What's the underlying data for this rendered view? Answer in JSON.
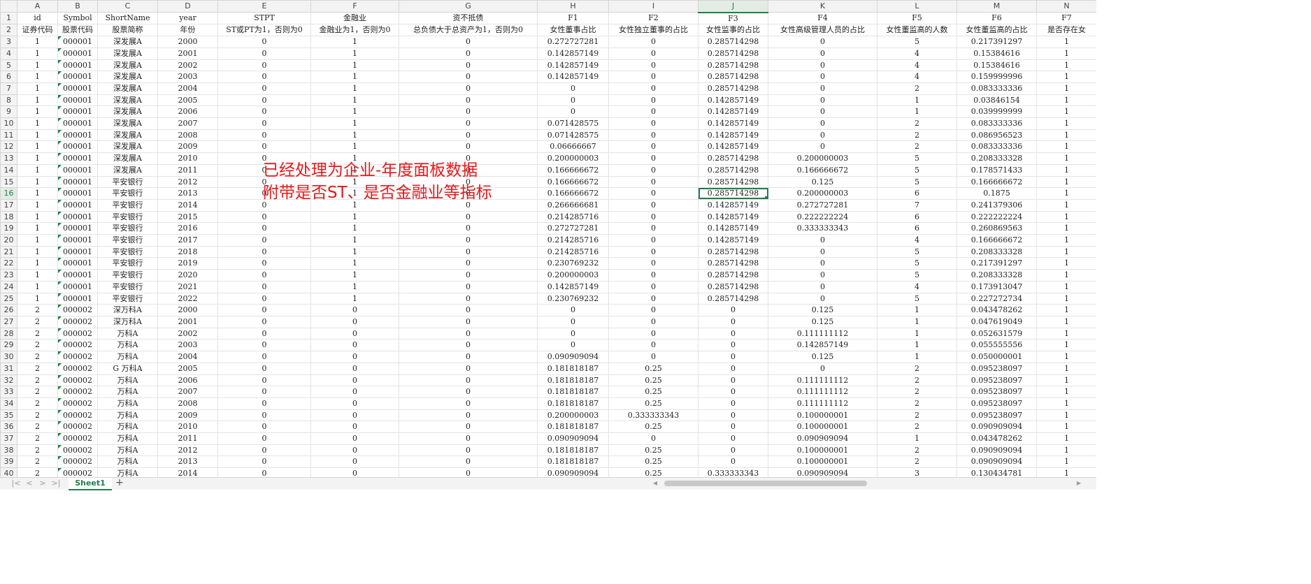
{
  "sheet": {
    "tab_label": "Sheet1",
    "add_sheet_label": "+",
    "nav": [
      "|<",
      "<",
      ">",
      ">|"
    ],
    "active_cell": {
      "row": 16,
      "col": "J"
    },
    "columns": [
      "A",
      "B",
      "C",
      "D",
      "E",
      "F",
      "G",
      "H",
      "I",
      "J",
      "K",
      "L",
      "M",
      "N"
    ],
    "header_row1": [
      "id",
      "Symbol",
      "ShortName",
      "year",
      "STPT",
      "金融业",
      "资不抵债",
      "F1",
      "F2",
      "F3",
      "F4",
      "F5",
      "F6",
      "F7"
    ],
    "header_row2": [
      "证券代码",
      "股票代码",
      "股票简称",
      "年份",
      "ST或PT为1，否则为0",
      "金融业为1，否则为0",
      "总负债大于总资产为1，否则为0",
      "女性董事占比",
      "女性独立董事的占比",
      "女性监事的占比",
      "女性高级管理人员的占比",
      "女性董监高的人数",
      "女性董监高的占比",
      "是否存在女"
    ],
    "rows": [
      {
        "n": 3,
        "c": [
          "1",
          "000001",
          "深发展A",
          "2000",
          "0",
          "1",
          "0",
          "0.272727281",
          "0",
          "0.285714298",
          "0",
          "5",
          "0.217391297",
          "1"
        ]
      },
      {
        "n": 4,
        "c": [
          "1",
          "000001",
          "深发展A",
          "2001",
          "0",
          "1",
          "0",
          "0.142857149",
          "0",
          "0.285714298",
          "0",
          "4",
          "0.15384616",
          "1"
        ]
      },
      {
        "n": 5,
        "c": [
          "1",
          "000001",
          "深发展A",
          "2002",
          "0",
          "1",
          "0",
          "0.142857149",
          "0",
          "0.285714298",
          "0",
          "4",
          "0.15384616",
          "1"
        ]
      },
      {
        "n": 6,
        "c": [
          "1",
          "000001",
          "深发展A",
          "2003",
          "0",
          "1",
          "0",
          "0.142857149",
          "0",
          "0.285714298",
          "0",
          "4",
          "0.159999996",
          "1"
        ]
      },
      {
        "n": 7,
        "c": [
          "1",
          "000001",
          "深发展A",
          "2004",
          "0",
          "1",
          "0",
          "0",
          "0",
          "0.285714298",
          "0",
          "2",
          "0.083333336",
          "1"
        ]
      },
      {
        "n": 8,
        "c": [
          "1",
          "000001",
          "深发展A",
          "2005",
          "0",
          "1",
          "0",
          "0",
          "0",
          "0.142857149",
          "0",
          "1",
          "0.03846154",
          "1"
        ]
      },
      {
        "n": 9,
        "c": [
          "1",
          "000001",
          "深发展A",
          "2006",
          "0",
          "1",
          "0",
          "0",
          "0",
          "0.142857149",
          "0",
          "1",
          "0.039999999",
          "1"
        ]
      },
      {
        "n": 10,
        "c": [
          "1",
          "000001",
          "深发展A",
          "2007",
          "0",
          "1",
          "0",
          "0.071428575",
          "0",
          "0.142857149",
          "0",
          "2",
          "0.083333336",
          "1"
        ]
      },
      {
        "n": 11,
        "c": [
          "1",
          "000001",
          "深发展A",
          "2008",
          "0",
          "1",
          "0",
          "0.071428575",
          "0",
          "0.142857149",
          "0",
          "2",
          "0.086956523",
          "1"
        ]
      },
      {
        "n": 12,
        "c": [
          "1",
          "000001",
          "深发展A",
          "2009",
          "0",
          "1",
          "0",
          "0.06666667",
          "0",
          "0.142857149",
          "0",
          "2",
          "0.083333336",
          "1"
        ]
      },
      {
        "n": 13,
        "c": [
          "1",
          "000001",
          "深发展A",
          "2010",
          "0",
          "1",
          "0",
          "0.200000003",
          "0",
          "0.285714298",
          "0.200000003",
          "5",
          "0.208333328",
          "1"
        ]
      },
      {
        "n": 14,
        "c": [
          "1",
          "000001",
          "深发展A",
          "2011",
          "0",
          "1",
          "0",
          "0.166666672",
          "0",
          "0.285714298",
          "0.166666672",
          "5",
          "0.178571433",
          "1"
        ]
      },
      {
        "n": 15,
        "c": [
          "1",
          "000001",
          "平安银行",
          "2012",
          "0",
          "1",
          "0",
          "0.166666672",
          "0",
          "0.285714298",
          "0.125",
          "5",
          "0.166666672",
          "1"
        ]
      },
      {
        "n": 16,
        "c": [
          "1",
          "000001",
          "平安银行",
          "2013",
          "0",
          "1",
          "0",
          "0.166666672",
          "0",
          "0.285714298",
          "0.200000003",
          "6",
          "0.1875",
          "1"
        ]
      },
      {
        "n": 17,
        "c": [
          "1",
          "000001",
          "平安银行",
          "2014",
          "0",
          "1",
          "0",
          "0.266666681",
          "0",
          "0.142857149",
          "0.272727281",
          "7",
          "0.241379306",
          "1"
        ]
      },
      {
        "n": 18,
        "c": [
          "1",
          "000001",
          "平安银行",
          "2015",
          "0",
          "1",
          "0",
          "0.214285716",
          "0",
          "0.142857149",
          "0.222222224",
          "6",
          "0.222222224",
          "1"
        ]
      },
      {
        "n": 19,
        "c": [
          "1",
          "000001",
          "平安银行",
          "2016",
          "0",
          "1",
          "0",
          "0.272727281",
          "0",
          "0.142857149",
          "0.333333343",
          "6",
          "0.260869563",
          "1"
        ]
      },
      {
        "n": 20,
        "c": [
          "1",
          "000001",
          "平安银行",
          "2017",
          "0",
          "1",
          "0",
          "0.214285716",
          "0",
          "0.142857149",
          "0",
          "4",
          "0.166666672",
          "1"
        ]
      },
      {
        "n": 21,
        "c": [
          "1",
          "000001",
          "平安银行",
          "2018",
          "0",
          "1",
          "0",
          "0.214285716",
          "0",
          "0.285714298",
          "0",
          "5",
          "0.208333328",
          "1"
        ]
      },
      {
        "n": 22,
        "c": [
          "1",
          "000001",
          "平安银行",
          "2019",
          "0",
          "1",
          "0",
          "0.230769232",
          "0",
          "0.285714298",
          "0",
          "5",
          "0.217391297",
          "1"
        ]
      },
      {
        "n": 23,
        "c": [
          "1",
          "000001",
          "平安银行",
          "2020",
          "0",
          "1",
          "0",
          "0.200000003",
          "0",
          "0.285714298",
          "0",
          "5",
          "0.208333328",
          "1"
        ]
      },
      {
        "n": 24,
        "c": [
          "1",
          "000001",
          "平安银行",
          "2021",
          "0",
          "1",
          "0",
          "0.142857149",
          "0",
          "0.285714298",
          "0",
          "4",
          "0.173913047",
          "1"
        ]
      },
      {
        "n": 25,
        "c": [
          "1",
          "000001",
          "平安银行",
          "2022",
          "0",
          "1",
          "0",
          "0.230769232",
          "0",
          "0.285714298",
          "0",
          "5",
          "0.227272734",
          "1"
        ]
      },
      {
        "n": 26,
        "c": [
          "2",
          "000002",
          "深万科A",
          "2000",
          "0",
          "0",
          "0",
          "0",
          "0",
          "0",
          "0.125",
          "1",
          "0.043478262",
          "1"
        ]
      },
      {
        "n": 27,
        "c": [
          "2",
          "000002",
          "深万科A",
          "2001",
          "0",
          "0",
          "0",
          "0",
          "0",
          "0",
          "0.125",
          "1",
          "0.047619049",
          "1"
        ]
      },
      {
        "n": 28,
        "c": [
          "2",
          "000002",
          "万科A",
          "2002",
          "0",
          "0",
          "0",
          "0",
          "0",
          "0",
          "0.111111112",
          "1",
          "0.052631579",
          "1"
        ]
      },
      {
        "n": 29,
        "c": [
          "2",
          "000002",
          "万科A",
          "2003",
          "0",
          "0",
          "0",
          "0",
          "0",
          "0",
          "0.142857149",
          "1",
          "0.055555556",
          "1"
        ]
      },
      {
        "n": 30,
        "c": [
          "2",
          "000002",
          "万科A",
          "2004",
          "0",
          "0",
          "0",
          "0.090909094",
          "0",
          "0",
          "0.125",
          "1",
          "0.050000001",
          "1"
        ]
      },
      {
        "n": 31,
        "c": [
          "2",
          "000002",
          "G 万科A",
          "2005",
          "0",
          "0",
          "0",
          "0.181818187",
          "0.25",
          "0",
          "0",
          "2",
          "0.095238097",
          "1"
        ]
      },
      {
        "n": 32,
        "c": [
          "2",
          "000002",
          "万科A",
          "2006",
          "0",
          "0",
          "0",
          "0.181818187",
          "0.25",
          "0",
          "0.111111112",
          "2",
          "0.095238097",
          "1"
        ]
      },
      {
        "n": 33,
        "c": [
          "2",
          "000002",
          "万科A",
          "2007",
          "0",
          "0",
          "0",
          "0.181818187",
          "0.25",
          "0",
          "0.111111112",
          "2",
          "0.095238097",
          "1"
        ]
      },
      {
        "n": 34,
        "c": [
          "2",
          "000002",
          "万科A",
          "2008",
          "0",
          "0",
          "0",
          "0.181818187",
          "0.25",
          "0",
          "0.111111112",
          "2",
          "0.095238097",
          "1"
        ]
      },
      {
        "n": 35,
        "c": [
          "2",
          "000002",
          "万科A",
          "2009",
          "0",
          "0",
          "0",
          "0.200000003",
          "0.333333343",
          "0",
          "0.100000001",
          "2",
          "0.095238097",
          "1"
        ]
      },
      {
        "n": 36,
        "c": [
          "2",
          "000002",
          "万科A",
          "2010",
          "0",
          "0",
          "0",
          "0.181818187",
          "0.25",
          "0",
          "0.100000001",
          "2",
          "0.090909094",
          "1"
        ]
      },
      {
        "n": 37,
        "c": [
          "2",
          "000002",
          "万科A",
          "2011",
          "0",
          "0",
          "0",
          "0.090909094",
          "0",
          "0",
          "0.090909094",
          "1",
          "0.043478262",
          "1"
        ]
      },
      {
        "n": 38,
        "c": [
          "2",
          "000002",
          "万科A",
          "2012",
          "0",
          "0",
          "0",
          "0.181818187",
          "0.25",
          "0",
          "0.100000001",
          "2",
          "0.090909094",
          "1"
        ]
      },
      {
        "n": 39,
        "c": [
          "2",
          "000002",
          "万科A",
          "2013",
          "0",
          "0",
          "0",
          "0.181818187",
          "0.25",
          "0",
          "0.100000001",
          "2",
          "0.090909094",
          "1"
        ]
      },
      {
        "n": 40,
        "c": [
          "2",
          "000002",
          "万科A",
          "2014",
          "0",
          "0",
          "0",
          "0.090909094",
          "0.25",
          "0.333333343",
          "0.090909094",
          "3",
          "0.130434781",
          "1"
        ]
      }
    ]
  },
  "overlay_note": {
    "line1": "已经处理为企业-年度面板数据",
    "line2": "附带是否ST、是否金融业等指标",
    "color": "#e5191b"
  },
  "colors": {
    "accent": "#1e7f46",
    "header_bg": "#f3f3f3",
    "grid_line": "#e3e3e3"
  }
}
